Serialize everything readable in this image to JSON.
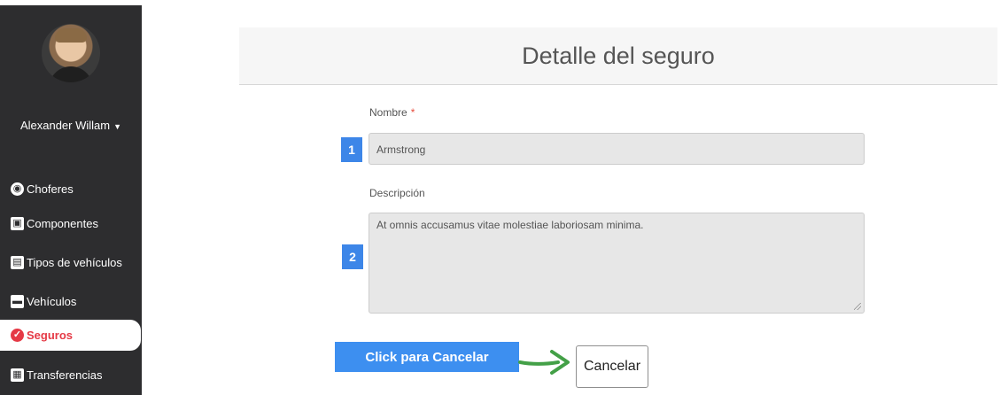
{
  "sidebar": {
    "user_name": "Alexander Willam",
    "items": [
      {
        "label": "Choferes",
        "icon": "steering-wheel-icon",
        "active": false
      },
      {
        "label": "Componentes",
        "icon": "component-icon",
        "active": false
      },
      {
        "label": "Tipos de vehículos",
        "icon": "bus-icon",
        "active": false
      },
      {
        "label": "Vehículos",
        "icon": "car-icon",
        "active": false
      },
      {
        "label": "Seguros",
        "icon": "shield-icon",
        "active": true
      },
      {
        "label": "Transferencias",
        "icon": "transfer-icon",
        "active": false
      }
    ]
  },
  "page": {
    "title": "Detalle del seguro"
  },
  "form": {
    "name_label": "Nombre",
    "required_mark": "*",
    "name_value": "Armstrong",
    "description_label": "Descripción",
    "description_value": "At omnis accusamus vitae molestiae laboriosam minima.",
    "step_1": "1",
    "step_2": "2",
    "callout": "Click para Cancelar",
    "cancel_label": "Cancelar"
  },
  "colors": {
    "sidebar": "#2d2d2f",
    "active": "#e53945",
    "step_badge": "#3d86e8",
    "callout": "#3d8ff0",
    "arrow": "#43a047"
  }
}
